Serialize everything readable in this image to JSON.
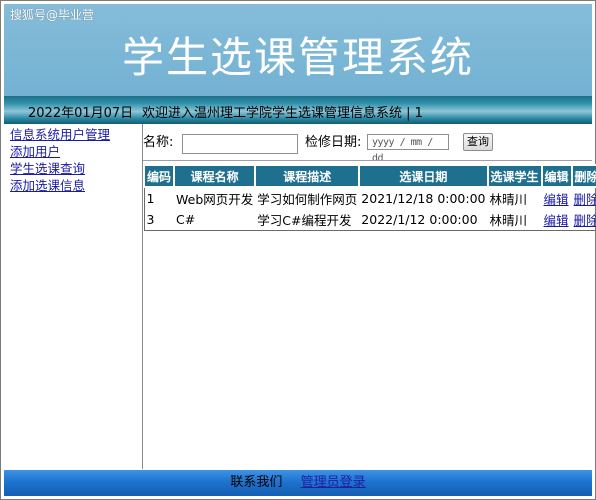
{
  "watermark": "搜狐号@毕业营",
  "banner": {
    "title": "学生选课管理系统"
  },
  "status": {
    "date": "2022年01月07日",
    "welcome": "欢迎进入温州理工学院学生选课管理信息系统 | 1"
  },
  "sidebar": {
    "items": [
      {
        "label": "信息系统用户管理"
      },
      {
        "label": "添加用户"
      },
      {
        "label": "学生选课查询"
      },
      {
        "label": "添加选课信息"
      }
    ]
  },
  "search": {
    "name_label": "名称:",
    "name_value": "",
    "date_label": "检修日期:",
    "date_placeholder": "yyyy / mm / dd",
    "query_button": "查询"
  },
  "table": {
    "headers": [
      "编码",
      "课程名称",
      "课程描述",
      "选课日期",
      "选课学生",
      "编辑",
      "删除"
    ],
    "rows": [
      {
        "code": "1",
        "name": "Web网页开发",
        "desc": "学习如何制作网页",
        "date": "2021/12/18 0:00:00",
        "student": "林晴川",
        "edit": "编辑",
        "delete": "删除"
      },
      {
        "code": "3",
        "name": "C#",
        "desc": "学习C#编程开发",
        "date": "2022/1/12 0:00:00",
        "student": "林晴川",
        "edit": "编辑",
        "delete": "删除"
      }
    ]
  },
  "footer": {
    "contact": "联系我们",
    "admin_login": "管理员登录"
  },
  "colors": {
    "banner": "#7ab6d6",
    "table_header": "#1f6f8e",
    "footer": "#1d73cf",
    "link": "#1a1aa6"
  }
}
